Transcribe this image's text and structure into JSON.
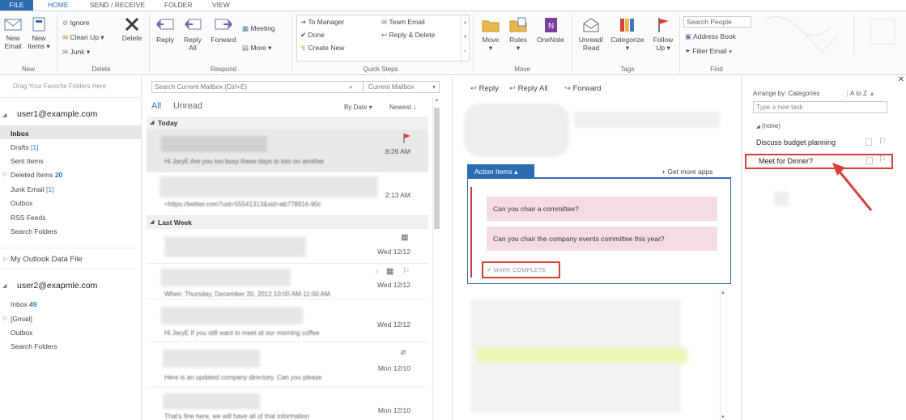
{
  "tabs": [
    "FILE",
    "HOME",
    "SEND / RECEIVE",
    "FOLDER",
    "VIEW"
  ],
  "ribbon": {
    "new_email": [
      "New",
      "Email"
    ],
    "new_items": [
      "New",
      "Items"
    ],
    "ignore": "Ignore",
    "clean_up": "Clean Up",
    "junk": "Junk",
    "delete": "Delete",
    "reply": "Reply",
    "reply_all": [
      "Reply",
      "All"
    ],
    "forward": "Forward",
    "meeting": "Meeting",
    "more": "More",
    "quick_steps": [
      "To Manager",
      "Done",
      "Create New",
      "Team Email",
      "Reply & Delete"
    ],
    "move": "Move",
    "rules": "Rules",
    "onenote": "OneNote",
    "unread_read": [
      "Unread/",
      "Read"
    ],
    "categorize": "Categorize",
    "follow_up": [
      "Follow",
      "Up"
    ],
    "search_people": "Search People",
    "address_book": "Address Book",
    "filter_email": "Filter Email",
    "groups": [
      "New",
      "Delete",
      "Respond",
      "Quick Steps",
      "Move",
      "Tags",
      "Find"
    ]
  },
  "left_pane": {
    "favorites_hint": "Drag Your Favorite Folders Here",
    "account1": "user1@example.com",
    "folders1": [
      {
        "name": "Inbox",
        "count": ""
      },
      {
        "name": "Drafts",
        "count": "[1]"
      },
      {
        "name": "Sent Items",
        "count": ""
      },
      {
        "name": "Deleted Items",
        "count": "20"
      },
      {
        "name": "Junk Email",
        "count": "[1]"
      },
      {
        "name": "Outbox",
        "count": ""
      },
      {
        "name": "RSS Feeds",
        "count": ""
      },
      {
        "name": "Search Folders",
        "count": ""
      }
    ],
    "data_file": "My Outlook Data File",
    "account2": "user2@exapmle.com",
    "folders2": [
      {
        "name": "Inbox",
        "count": "49"
      },
      {
        "name": "[Gmail]",
        "count": ""
      },
      {
        "name": "Outbox",
        "count": ""
      },
      {
        "name": "Search Folders",
        "count": ""
      }
    ]
  },
  "mail_list": {
    "search_placeholder": "Search Current Mailbox (Ctrl+E)",
    "scope": "Current Mailbox",
    "filter_all": "All",
    "filter_unread": "Unread",
    "sort_by": "By Date",
    "sort_order": "Newest",
    "sections": [
      "Today",
      "Last Week"
    ],
    "items": [
      {
        "preview": "Hi JaryE Are you too busy these days to tolo on another",
        "date": "8:26 AM"
      },
      {
        "preview": "<https://twitter.com?uid=55541313&sid=ab778916-90c",
        "date": "2:13 AM"
      },
      {
        "preview": "",
        "date": "Wed 12/12"
      },
      {
        "preview": "When: Thursday, December 20, 2012 10:00 AM-11:00 AM.",
        "date": "Wed 12/12"
      },
      {
        "preview": "Hi JaryE  If you still want to meet at our morning coffee",
        "date": "Wed 12/12"
      },
      {
        "preview": "Here is an updated company directory. Can you please",
        "date": "Mon 12/10"
      },
      {
        "preview": "That's fine here, we will have all of that information",
        "date": "Mon 12/10"
      }
    ]
  },
  "reading": {
    "reply": "Reply",
    "reply_all": "Reply All",
    "forward": "Forward",
    "action_items_tab": "Action Items",
    "get_more_apps": "Get more apps",
    "items": [
      "Can you chair a committee?",
      "Can you chair the company events committee this year?"
    ],
    "mark_complete": "MARK COMPLETE"
  },
  "tasks": {
    "arrange_by": "Arrange by: Categories",
    "sort": "A to Z",
    "new_task_placeholder": "Type a new task",
    "group": "(none)",
    "items": [
      "Discuss budget planning",
      "Meet for Dinner?"
    ]
  },
  "colors": {
    "accent": "#2b6bb2",
    "highlight": "#d9403a",
    "action_item_bg": "#f3dde1",
    "selected_row": "#e8e8e8"
  }
}
